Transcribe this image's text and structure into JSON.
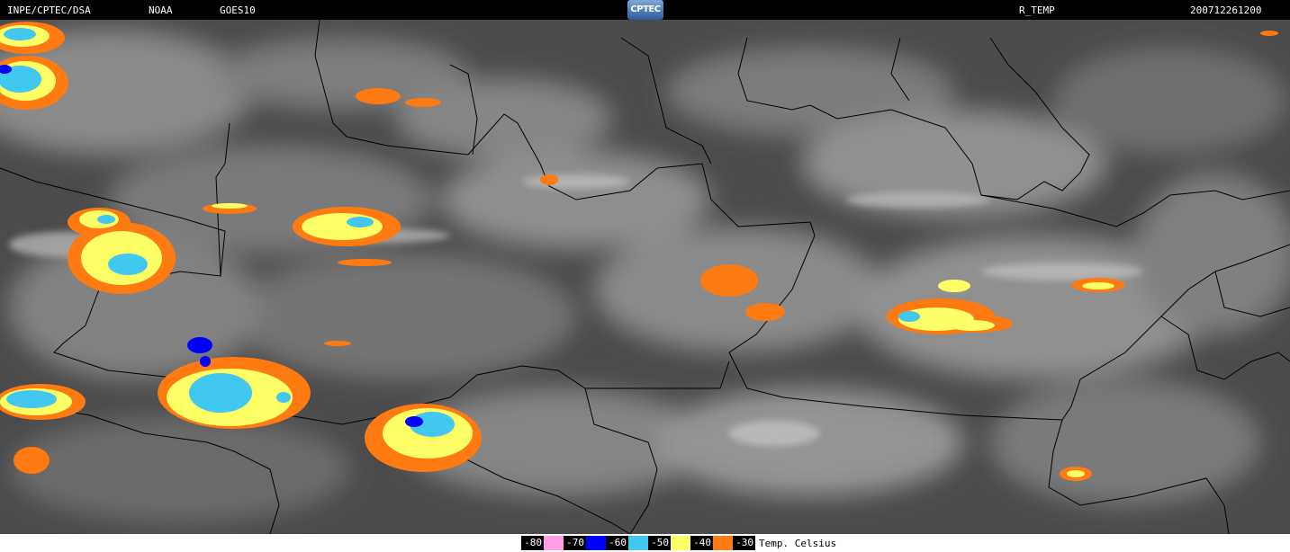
{
  "header": {
    "institution": "INPE/CPTEC/DSA",
    "agency": "NOAA",
    "satellite": "GOES10",
    "logo_text": "CPTEC",
    "product": "R_TEMP",
    "timestamp": "200712261200"
  },
  "legend": {
    "unit_label": "Temp. Celsius",
    "items": [
      {
        "label": "-80",
        "color": "#ff9ee8"
      },
      {
        "label": "-70",
        "color": "#0000ff"
      },
      {
        "label": "-60",
        "color": "#40c8f0"
      },
      {
        "label": "-50",
        "color": "#ffff66"
      },
      {
        "label": "-40",
        "color": "#ff7a10"
      },
      {
        "label": "-30",
        "color": ""
      }
    ]
  },
  "colors": {
    "background_gray": "#4a4a4a",
    "cloud_gray": "#9a9a9a",
    "border_line": "#000000"
  }
}
